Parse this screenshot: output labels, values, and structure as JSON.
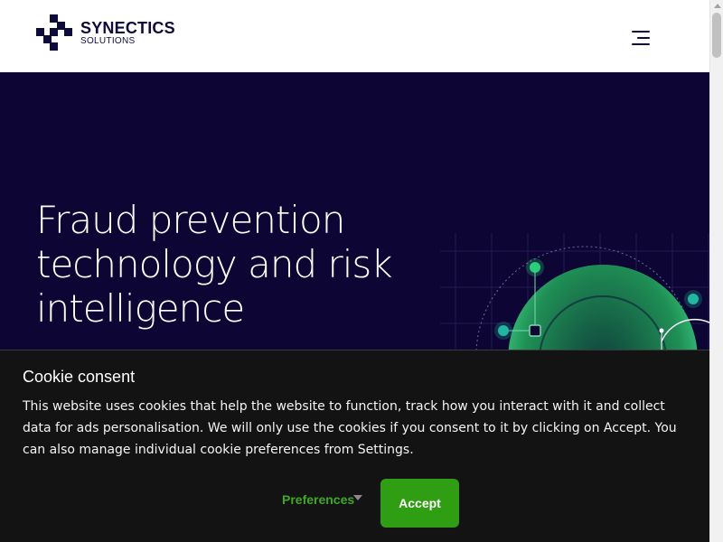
{
  "header": {
    "logo_name": "SYNECTICS",
    "logo_sub": "SOLUTIONS",
    "menu_icon": "hamburger-menu-icon"
  },
  "hero": {
    "title": "Fraud prevention technology and risk intelligence",
    "graphic_icon": "network-globe-graphic"
  },
  "colors": {
    "brand_navy": "#0f0a3c",
    "hero_bg": "#0d0634",
    "accent_green": "#2f9e12",
    "cookie_bg": "#141313"
  },
  "cookie": {
    "title": "Cookie consent",
    "text": "This website uses cookies that help the website to function, track how you interact with it and collect data for ads personalisation. We will only use the cookies if you consent to it by clicking on Accept. You can also manage individual cookie preferences from Settings.",
    "preferences_label": "Preferences",
    "accept_label": "Accept"
  }
}
